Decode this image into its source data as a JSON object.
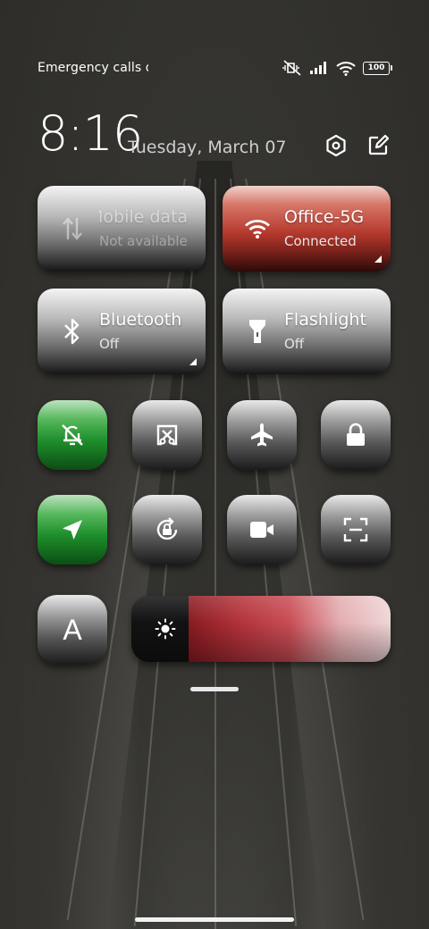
{
  "status_bar": {
    "carrier_text": "Emergency calls o",
    "icons": [
      "mute-vibrate-icon",
      "signal-icon",
      "wifi-icon",
      "battery-icon"
    ],
    "battery_level": "100"
  },
  "header": {
    "time": "8:16",
    "date": "Tuesday, March 07",
    "actions": [
      "settings-icon",
      "edit-icon"
    ]
  },
  "tiles": {
    "mobile_data": {
      "title": "Mobile data",
      "subtitle": "Not available",
      "icon": "data-arrows-icon",
      "state": "disabled"
    },
    "wifi": {
      "title": "Office-5G",
      "subtitle": "Connected",
      "icon": "wifi-icon",
      "state": "on",
      "color": "#b5392d"
    },
    "bluetooth": {
      "title": "Bluetooth",
      "subtitle": "Off",
      "icon": "bluetooth-icon",
      "state": "off"
    },
    "flashlight": {
      "title": "Flashlight",
      "subtitle": "Off",
      "icon": "flashlight-icon",
      "state": "off"
    }
  },
  "toggles": [
    {
      "name": "mute",
      "icon": "bell-off-icon",
      "state": "on",
      "color": "#1e8e2b"
    },
    {
      "name": "screen-cast",
      "icon": "screen-cast-icon",
      "state": "off"
    },
    {
      "name": "airplane-mode",
      "icon": "airplane-icon",
      "state": "off"
    },
    {
      "name": "lock-screen",
      "icon": "lock-icon",
      "state": "off"
    },
    {
      "name": "location",
      "icon": "location-arrow-icon",
      "state": "on",
      "color": "#1e8e2b"
    },
    {
      "name": "auto-rotate",
      "icon": "rotate-lock-icon",
      "state": "off"
    },
    {
      "name": "screen-recorder",
      "icon": "video-camera-icon",
      "state": "off"
    },
    {
      "name": "scanner",
      "icon": "scan-icon",
      "state": "off"
    },
    {
      "name": "text-size",
      "icon": "text-a-icon",
      "state": "off",
      "label": "A"
    }
  ],
  "brightness": {
    "icon": "sun-icon",
    "level": 0.2,
    "color": "#b3323a"
  }
}
